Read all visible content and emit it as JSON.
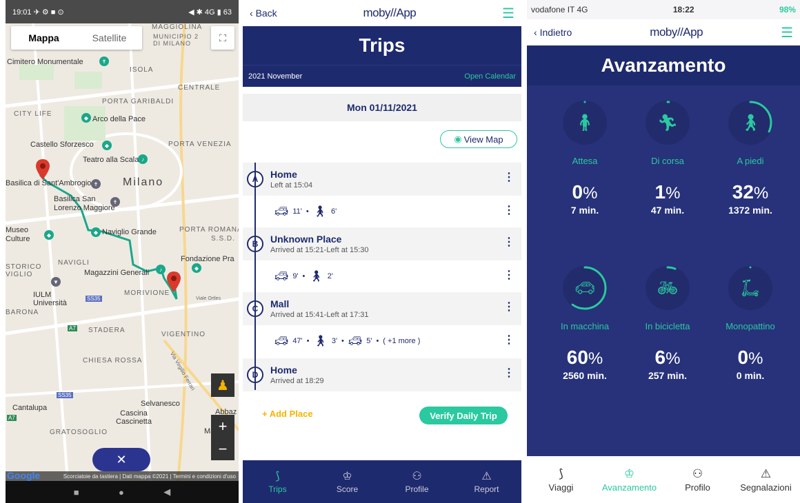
{
  "map_screen": {
    "status_time": "19:01",
    "status_icons": "✈ ⚙ ■ ⊙",
    "status_right": "◀ ✱ 4G ▮ 63",
    "toggle": {
      "map": "Mappa",
      "satellite": "Satellite"
    },
    "labels": {
      "maggiolina": "MAGGIOLINA",
      "municipio": "MUNICIPIO 2 DI MILANO",
      "cimitero": "Cimitero Monumentale",
      "isola": "ISOLA",
      "centrale": "CENTRALE",
      "garibaldi": "PORTA GARIBALDI",
      "citylife": "CITY LIFE",
      "arco": "Arco della Pace",
      "sforzesco": "Castello Sforzesco",
      "venezia": "PORTA VENEZIA",
      "teatro": "Teatro alla Scala",
      "milano": "Milano",
      "ambrogio": "Basilica di Sant'Ambrogio",
      "lorenzo": "Basilica San Lorenzo Maggiore",
      "museo": "Museo Culture",
      "naviglio": "Naviglio Grande",
      "romana": "PORTA ROMANA",
      "sds": "S.S.D.",
      "fondazione": "Fondazione Pra",
      "navigli": "NAVIGLI",
      "storico": "STORICO VIGLIO",
      "magazzini": "Magazzini Generali",
      "morivione": "MORIVIONE",
      "iulm": "IULM Università",
      "barona": "BARONA",
      "stadera": "STADERA",
      "vigentino": "VIGENTINO",
      "chiesarossa": "CHIESA ROSSA",
      "cantalupa": "Cantalupa",
      "selvanesco": "Selvanesco",
      "cascina": "Cascina Cascinetta",
      "gratosoglio": "GRATOSOGLIO",
      "abbaz": "Abbaz",
      "mac": "Mac",
      "viaortles": "Viale Ortles",
      "viavigentina": "Via Virgilio Ferrari",
      "ss35": "SS35",
      "a7": "A7"
    },
    "close_glyph": "✕",
    "zoom_in": "+",
    "zoom_out": "−",
    "footer": "Scorciatoie da tastiera | Dati mappa ©2021 | Termini e condizioni d'uso",
    "google": "Google",
    "nav": [
      "■",
      "●",
      "◀"
    ],
    "colors": {
      "route": "#1aa78a",
      "pin": "#d93a2b"
    }
  },
  "trips_screen": {
    "back": "Back",
    "logo": "moby//App",
    "title": "Trips",
    "month": "2021 November",
    "open_calendar": "Open Calendar",
    "date": "Mon 01/11/2021",
    "view_map": "View Map",
    "places": [
      {
        "letter": "A",
        "name": "Home",
        "sub": "Left at 15:04"
      },
      {
        "letter": "B",
        "name": "Unknown Place",
        "sub": "Arrived at 15:21-Left at 15:30"
      },
      {
        "letter": "C",
        "name": "Mall",
        "sub": "Arrived at 15:41-Left at 17:31"
      },
      {
        "letter": "D",
        "name": "Home",
        "sub": "Arrived at 18:29"
      }
    ],
    "legs": [
      {
        "car": "11'",
        "walk": "6'"
      },
      {
        "car": "9'",
        "walk": "2'"
      },
      {
        "car": "47'",
        "walk": "3'",
        "car2": "5'",
        "more": "( +1 more )"
      }
    ],
    "add_place": "+ Add Place",
    "verify": "Verify Daily Trip",
    "tabs": [
      {
        "label": "Trips",
        "icon": "route-icon"
      },
      {
        "label": "Score",
        "icon": "trophy-icon"
      },
      {
        "label": "Profile",
        "icon": "person-icon"
      },
      {
        "label": "Report",
        "icon": "warning-icon"
      }
    ],
    "colors": {
      "navy": "#1e2a6e",
      "teal": "#2bc9a0",
      "yellow": "#f5b400"
    }
  },
  "progress_screen": {
    "carrier": "vodafone IT 4G",
    "time": "18:22",
    "battery": "98%",
    "back": "Indietro",
    "logo": "moby//App",
    "title": "Avanzamento",
    "modes": [
      {
        "label": "Attesa",
        "pct": "0",
        "min": "7 min.",
        "icon": "standing-person-icon",
        "fraction": 0
      },
      {
        "label": "Di corsa",
        "pct": "1",
        "min": "47 min.",
        "icon": "running-icon",
        "fraction": 0.01
      },
      {
        "label": "A piedi",
        "pct": "32",
        "min": "1372 min.",
        "icon": "walking-icon",
        "fraction": 0.32
      },
      {
        "label": "In macchina",
        "pct": "60",
        "min": "2560 min.",
        "icon": "car-icon",
        "fraction": 0.6
      },
      {
        "label": "In bicicletta",
        "pct": "6",
        "min": "257 min.",
        "icon": "bicycle-icon",
        "fraction": 0.06
      },
      {
        "label": "Monopattino",
        "pct": "0",
        "min": "0 min.",
        "icon": "scooter-icon",
        "fraction": 0
      }
    ],
    "tabs": [
      {
        "label": "Viaggi",
        "icon": "route-icon"
      },
      {
        "label": "Avanzamento",
        "icon": "trophy-icon"
      },
      {
        "label": "Profilo",
        "icon": "person-icon"
      },
      {
        "label": "Segnalazioni",
        "icon": "warning-icon"
      }
    ]
  }
}
